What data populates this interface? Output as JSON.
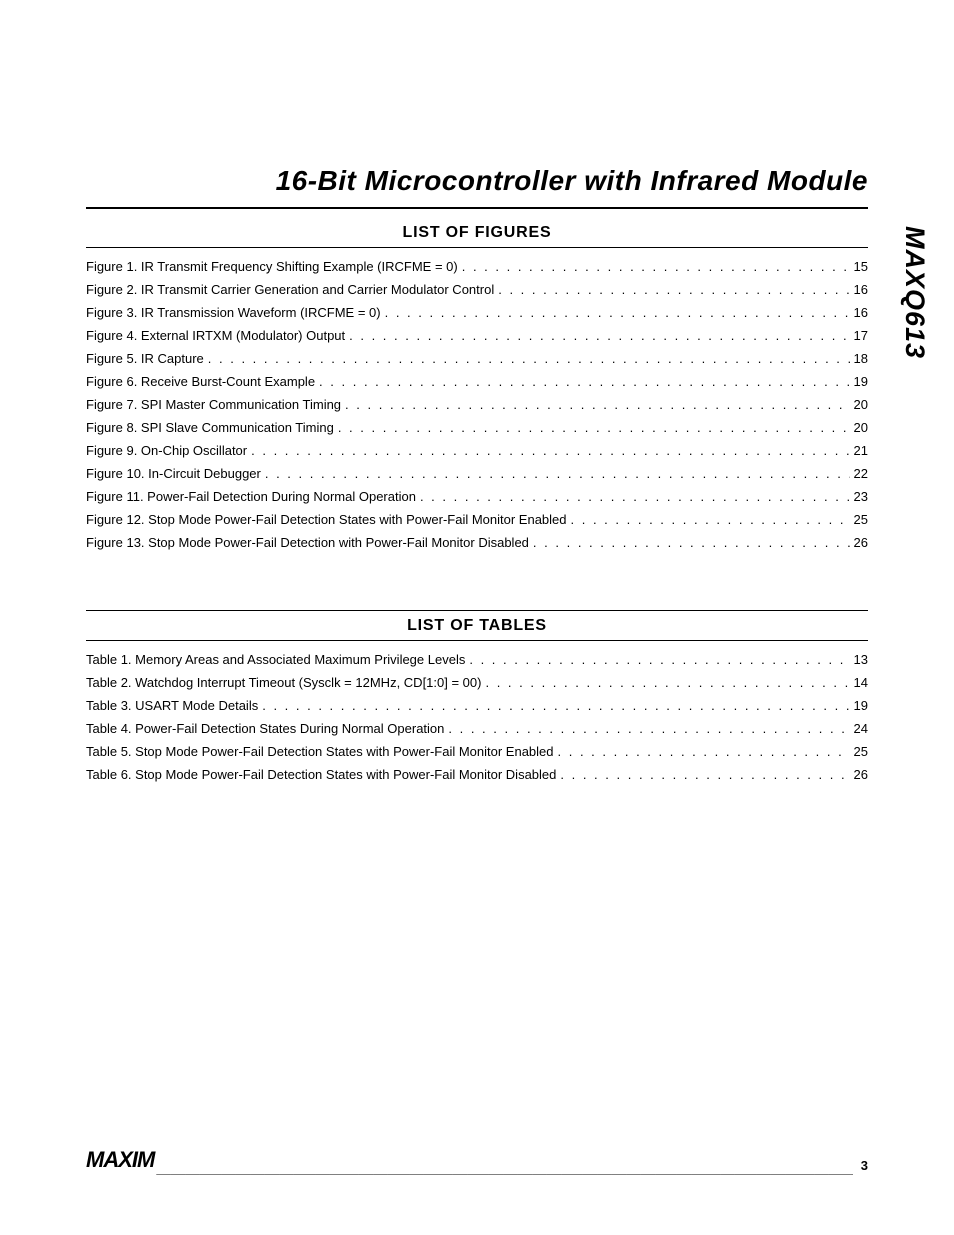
{
  "title": "16-Bit Microcontroller with Infrared Module",
  "product": "MAXQ613",
  "brand": "MAXIM",
  "page_number": "3",
  "sections": {
    "figures": {
      "heading": "LIST OF FIGURES",
      "items": [
        {
          "label": "Figure 1. IR Transmit Frequency Shifting Example (IRCFME = 0)",
          "page": "15"
        },
        {
          "label": "Figure 2. IR Transmit Carrier Generation and Carrier Modulator Control",
          "page": "16"
        },
        {
          "label": "Figure 3. IR Transmission Waveform (IRCFME = 0)",
          "page": "16"
        },
        {
          "label": "Figure 4. External IRTXM (Modulator) Output",
          "page": "17"
        },
        {
          "label": "Figure 5. IR Capture",
          "page": "18"
        },
        {
          "label": "Figure 6. Receive Burst-Count Example",
          "page": "19"
        },
        {
          "label": "Figure 7. SPI Master Communication Timing",
          "page": "20"
        },
        {
          "label": "Figure 8. SPI Slave Communication Timing",
          "page": "20"
        },
        {
          "label": "Figure 9. On-Chip Oscillator",
          "page": "21"
        },
        {
          "label": "Figure 10. In-Circuit Debugger",
          "page": "22"
        },
        {
          "label": "Figure 11. Power-Fail Detection During Normal Operation",
          "page": "23"
        },
        {
          "label": "Figure 12. Stop Mode Power-Fail Detection States with Power-Fail Monitor Enabled",
          "page": "25"
        },
        {
          "label": "Figure 13. Stop Mode Power-Fail Detection with Power-Fail Monitor Disabled",
          "page": "26"
        }
      ]
    },
    "tables": {
      "heading": "LIST OF TABLES",
      "items": [
        {
          "label": "Table 1. Memory Areas and Associated Maximum Privilege Levels",
          "page": "13"
        },
        {
          "label": "Table 2. Watchdog Interrupt Timeout (Sysclk = 12MHz, CD[1:0] = 00)",
          "page": "14"
        },
        {
          "label": "Table 3. USART Mode Details",
          "page": "19"
        },
        {
          "label": "Table 4. Power-Fail Detection States During Normal Operation",
          "page": "24"
        },
        {
          "label": "Table 5. Stop Mode Power-Fail Detection States with Power-Fail Monitor Enabled",
          "page": "25"
        },
        {
          "label": "Table 6. Stop Mode Power-Fail Detection States with Power-Fail Monitor Disabled",
          "page": "26"
        }
      ]
    }
  }
}
